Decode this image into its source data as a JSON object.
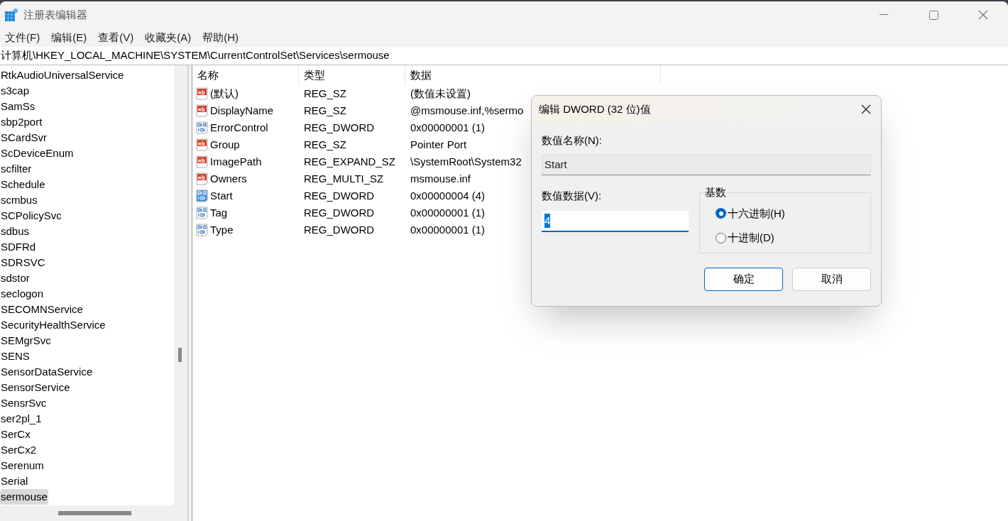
{
  "window": {
    "title": "注册表编辑器"
  },
  "menu": [
    "文件(F)",
    "编辑(E)",
    "查看(V)",
    "收藏夹(A)",
    "帮助(H)"
  ],
  "address": "计算机\\HKEY_LOCAL_MACHINE\\SYSTEM\\CurrentControlSet\\Services\\sermouse",
  "tree": {
    "items": [
      {
        "label": "RtkAudioUniversalService",
        "selected": false
      },
      {
        "label": "s3cap",
        "selected": false
      },
      {
        "label": "SamSs",
        "selected": false
      },
      {
        "label": "sbp2port",
        "selected": false
      },
      {
        "label": "SCardSvr",
        "selected": false
      },
      {
        "label": "ScDeviceEnum",
        "selected": false
      },
      {
        "label": "scfilter",
        "selected": false
      },
      {
        "label": "Schedule",
        "selected": false
      },
      {
        "label": "scmbus",
        "selected": false
      },
      {
        "label": "SCPolicySvc",
        "selected": false
      },
      {
        "label": "sdbus",
        "selected": false
      },
      {
        "label": "SDFRd",
        "selected": false
      },
      {
        "label": "SDRSVC",
        "selected": false
      },
      {
        "label": "sdstor",
        "selected": false
      },
      {
        "label": "seclogon",
        "selected": false
      },
      {
        "label": "SECOMNService",
        "selected": false
      },
      {
        "label": "SecurityHealthService",
        "selected": false
      },
      {
        "label": "SEMgrSvc",
        "selected": false
      },
      {
        "label": "SENS",
        "selected": false
      },
      {
        "label": "SensorDataService",
        "selected": false
      },
      {
        "label": "SensorService",
        "selected": false
      },
      {
        "label": "SensrSvc",
        "selected": false
      },
      {
        "label": "ser2pl_1",
        "selected": false
      },
      {
        "label": "SerCx",
        "selected": false
      },
      {
        "label": "SerCx2",
        "selected": false
      },
      {
        "label": "Serenum",
        "selected": false
      },
      {
        "label": "Serial",
        "selected": false
      },
      {
        "label": "sermouse",
        "selected": true
      }
    ]
  },
  "table": {
    "columns": [
      "名称",
      "类型",
      "数据"
    ],
    "rows": [
      {
        "kind": "string",
        "name": "(默认)",
        "type": "REG_SZ",
        "data": "(数值未设置)",
        "selected": false
      },
      {
        "kind": "string",
        "name": "DisplayName",
        "type": "REG_SZ",
        "data": "@msmouse.inf,%sermo",
        "selected": false
      },
      {
        "kind": "binary",
        "name": "ErrorControl",
        "type": "REG_DWORD",
        "data": "0x00000001 (1)",
        "selected": false
      },
      {
        "kind": "string",
        "name": "Group",
        "type": "REG_SZ",
        "data": "Pointer Port",
        "selected": false
      },
      {
        "kind": "string",
        "name": "ImagePath",
        "type": "REG_EXPAND_SZ",
        "data": "\\SystemRoot\\System32",
        "selected": false
      },
      {
        "kind": "string",
        "name": "Owners",
        "type": "REG_MULTI_SZ",
        "data": "msmouse.inf",
        "selected": false
      },
      {
        "kind": "binary",
        "name": "Start",
        "type": "REG_DWORD",
        "data": "0x00000004 (4)",
        "selected": true
      },
      {
        "kind": "binary",
        "name": "Tag",
        "type": "REG_DWORD",
        "data": "0x00000001 (1)",
        "selected": false
      },
      {
        "kind": "binary",
        "name": "Type",
        "type": "REG_DWORD",
        "data": "0x00000001 (1)",
        "selected": false
      }
    ]
  },
  "dialog": {
    "title": "编辑 DWORD (32 位)值",
    "name_label": "数值名称(N):",
    "name_value": "Start",
    "data_label": "数值数据(V):",
    "data_value": "4",
    "base_label": "基数",
    "radios": [
      {
        "label": "十六进制(H)",
        "selected": true
      },
      {
        "label": "十进制(D)",
        "selected": false
      }
    ],
    "buttons": [
      "确定",
      "取消"
    ]
  }
}
